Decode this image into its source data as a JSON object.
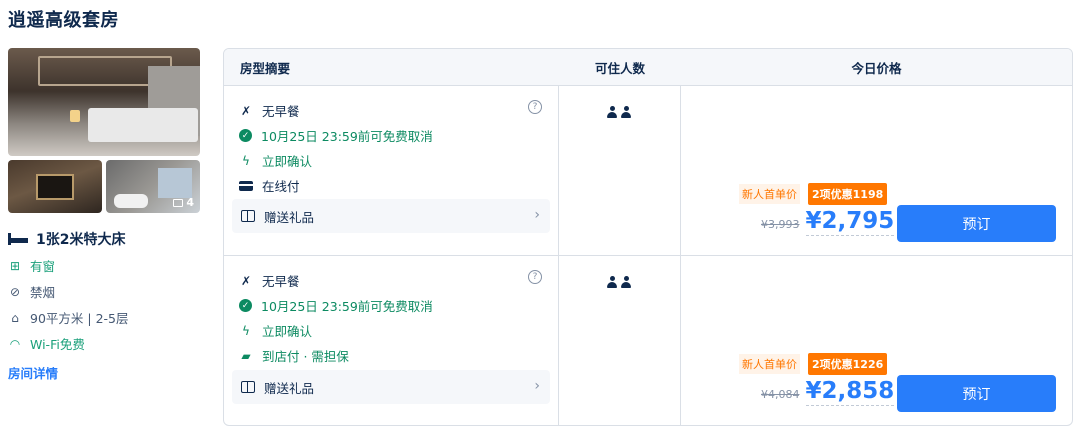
{
  "room_title": "逍遥高级套房",
  "gallery": {
    "photo_count": "4"
  },
  "room_info": {
    "bed": "1张2米特大床",
    "window": "有窗",
    "smoking": "禁烟",
    "area_floor": "90平方米 | 2-5层",
    "wifi": "Wi-Fi免费",
    "detail_link": "房间详情"
  },
  "table": {
    "headers": {
      "summary": "房型摘要",
      "guests": "可住人数",
      "price": "今日价格"
    }
  },
  "offers": [
    {
      "breakfast": "无早餐",
      "cancel": "10月25日 23:59前可免费取消",
      "confirm": "立即确认",
      "payment": "在线付",
      "gift": "赠送礼品",
      "new_user_tag": "新人首单价",
      "discount_tag": "2项优惠1198",
      "old_price": "¥3,993",
      "price": "¥2,795",
      "book_label": "预订"
    },
    {
      "breakfast": "无早餐",
      "cancel": "10月25日 23:59前可免费取消",
      "confirm": "立即确认",
      "payment": "到店付 · 需担保",
      "gift": "赠送礼品",
      "new_user_tag": "新人首单价",
      "discount_tag": "2项优惠1226",
      "old_price": "¥4,084",
      "price": "¥2,858",
      "book_label": "预订"
    }
  ],
  "colors": {
    "accent": "#287dfa",
    "green": "#0c8a61",
    "orange": "#ff7700",
    "text": "#0f294d"
  }
}
